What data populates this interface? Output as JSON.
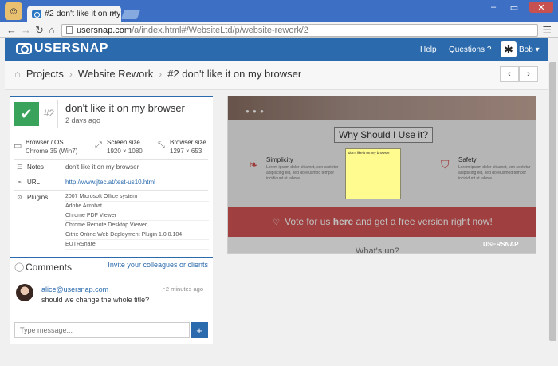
{
  "browser": {
    "tab_title": "#2 don't like it on my brow",
    "url_host": "usersnap.com",
    "url_path": "/a/index.html#/WebsiteLtd/p/website-rework/2",
    "back_icon": "arrow-left",
    "forward_icon": "arrow-right",
    "reload_icon": "reload",
    "home_icon": "home"
  },
  "header": {
    "logo": "USERSNAP",
    "help": "Help",
    "questions": "Questions",
    "user": "Bob"
  },
  "breadcrumb": {
    "items": [
      "Projects",
      "Website Rework",
      "#2 don't like it on my browser"
    ]
  },
  "ticket": {
    "number": "#2",
    "title": "don't like it on my browser",
    "age": "2 days ago",
    "browser_label": "Browser / OS",
    "browser_value": "Chrome 35 (Win7)",
    "screen_label": "Screen size",
    "screen_value": "1920 × 1080",
    "bsize_label": "Browser size",
    "bsize_value": "1297 × 653",
    "notes_label": "Notes",
    "notes_value": "don't like it on my browser",
    "url_label": "URL",
    "url_value": "http://www.jtec.at/test-us10.html",
    "plugins_label": "Plugins",
    "plugins": [
      "2007 Microsoft Office system",
      "Adobe Acrobat",
      "Chrome PDF Viewer",
      "Chrome Remote Desktop Viewer",
      "Citrix Online Web Deployment Plugin 1.0.0.104",
      "EUTRShare"
    ]
  },
  "comments": {
    "title": "Comments",
    "invite": "Invite your colleagues or clients",
    "items": [
      {
        "author": "alice@usersnap.com",
        "time": "2 minutes ago",
        "text": "should we change the whole title?"
      }
    ],
    "input_placeholder": "Type message...",
    "send": "+"
  },
  "preview": {
    "heading": "Why Should I Use it?",
    "col1_title": "Simplicity",
    "col2_title": "Safety",
    "col_text": "Lorem ipsum dolor sit amet, con sectetur adipiscing elit, sed do eiusmod tempor incididunt ut labore",
    "banner_pre": "Vote for us ",
    "banner_link": "here",
    "banner_post": " and get a free version right now!",
    "footer_title": "What's up?",
    "sticky_note": "don't like it on my browser",
    "watermark": "USERSNAP"
  }
}
